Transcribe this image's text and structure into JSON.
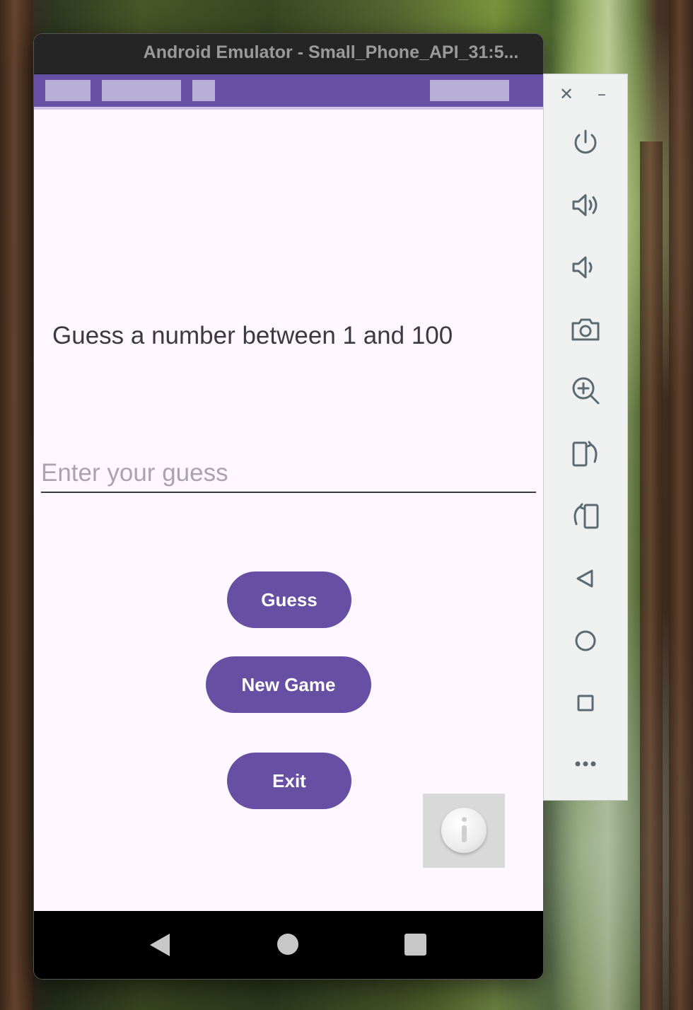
{
  "window": {
    "title": "Android Emulator - Small_Phone_API_31:5..."
  },
  "app": {
    "prompt": "Guess a number between 1 and 100",
    "guess_input": {
      "value": "",
      "placeholder": "Enter your guess"
    },
    "buttons": {
      "guess": "Guess",
      "new_game": "New Game",
      "exit": "Exit"
    }
  },
  "colors": {
    "primary": "#6750a4",
    "screen_background": "#fef7ff",
    "toolbar_icon": "#5b6a72"
  },
  "toolbar": {
    "window_controls": [
      "close-icon",
      "minimize-icon"
    ],
    "items": [
      "power-icon",
      "volume-up-icon",
      "volume-down-icon",
      "camera-icon",
      "zoom-in-icon",
      "rotate-left-icon",
      "rotate-right-icon",
      "back-icon",
      "home-icon",
      "overview-icon",
      "more-icon"
    ]
  },
  "nav_bar": {
    "items": [
      "back-icon",
      "home-icon",
      "recents-icon"
    ]
  }
}
